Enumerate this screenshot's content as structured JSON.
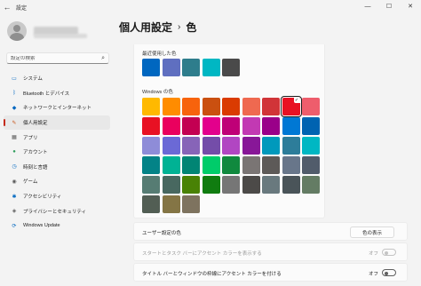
{
  "window": {
    "title": "設定",
    "back_glyph": "←",
    "minimize_glyph": "—",
    "maximize_glyph": "☐",
    "close_glyph": "✕"
  },
  "search": {
    "placeholder": "設定の検索",
    "icon": "search-icon"
  },
  "nav": {
    "items": [
      {
        "label": "システム",
        "icon": "monitor-icon",
        "color": "#0067c0",
        "glyph": "▭"
      },
      {
        "label": "Bluetooth とデバイス",
        "icon": "bluetooth-icon",
        "color": "#0067c0",
        "glyph": "ᛒ"
      },
      {
        "label": "ネットワークとインターネット",
        "icon": "wifi-icon",
        "color": "#0067c0",
        "glyph": "◆"
      },
      {
        "label": "個人用設定",
        "icon": "brush-icon",
        "color": "#c9571a",
        "glyph": "✎"
      },
      {
        "label": "アプリ",
        "icon": "apps-icon",
        "color": "#5a5a5a",
        "glyph": "▦"
      },
      {
        "label": "アカウント",
        "icon": "account-icon",
        "color": "#2e9d5c",
        "glyph": "●"
      },
      {
        "label": "時刻と言語",
        "icon": "clock-globe-icon",
        "color": "#0067c0",
        "glyph": "◷"
      },
      {
        "label": "ゲーム",
        "icon": "gamepad-icon",
        "color": "#5a5a5a",
        "glyph": "◉"
      },
      {
        "label": "アクセシビリティ",
        "icon": "accessibility-icon",
        "color": "#0067c0",
        "glyph": "✱"
      },
      {
        "label": "プライバシーとセキュリティ",
        "icon": "shield-icon",
        "color": "#5a5a5a",
        "glyph": "◈"
      },
      {
        "label": "Windows Update",
        "icon": "update-icon",
        "color": "#0067c0",
        "glyph": "⟳"
      }
    ],
    "active_index": 3
  },
  "header": {
    "parent": "個人用設定",
    "separator": "›",
    "current": "色"
  },
  "recent": {
    "label": "最近使用した色",
    "colors": [
      "#0067c0",
      "#5f6fc0",
      "#2e7d8c",
      "#00b7c3",
      "#4a4a4a"
    ]
  },
  "windows_colors": {
    "label": "Windows の色",
    "selected": "#e81123",
    "rows": [
      [
        "#ffb900",
        "#ff8c00",
        "#f7630c",
        "#ca5010",
        "#da3b01",
        "#ef6950",
        "#d13438",
        "#e81123",
        "#ee5d6c"
      ],
      [
        "#e81123",
        "#ea005e",
        "#c30052",
        "#e3008c",
        "#bf0077",
        "#c239b3",
        "#9a0089",
        "#0078d4",
        "#0063b1"
      ],
      [
        "#8e8cd8",
        "#6b69d6",
        "#8764b8",
        "#744da9",
        "#b146c2",
        "#881798",
        "#0099bc",
        "#2d7d9a",
        "#00b7c3"
      ],
      [
        "#038387",
        "#00b294",
        "#018574",
        "#00cc6a",
        "#10893e",
        "#7a7574",
        "#5d5a58",
        "#68768a",
        "#515c6b"
      ],
      [
        "#567c73",
        "#486860",
        "#498205",
        "#107c10",
        "#767676",
        "#4c4a48",
        "#69797e",
        "#4a5459",
        "#647c64"
      ],
      [
        "#525e54",
        "#847545",
        "#7e735f"
      ]
    ]
  },
  "custom": {
    "label": "ユーザー設定の色",
    "button": "色の表示"
  },
  "start_taskbar": {
    "label": "スタートとタスク バーにアクセント カラーを表示する",
    "state": "オフ"
  },
  "titlebar_accent": {
    "label": "タイトル バーとウィンドウの枠線にアクセント カラーを付ける",
    "state": "オフ"
  }
}
